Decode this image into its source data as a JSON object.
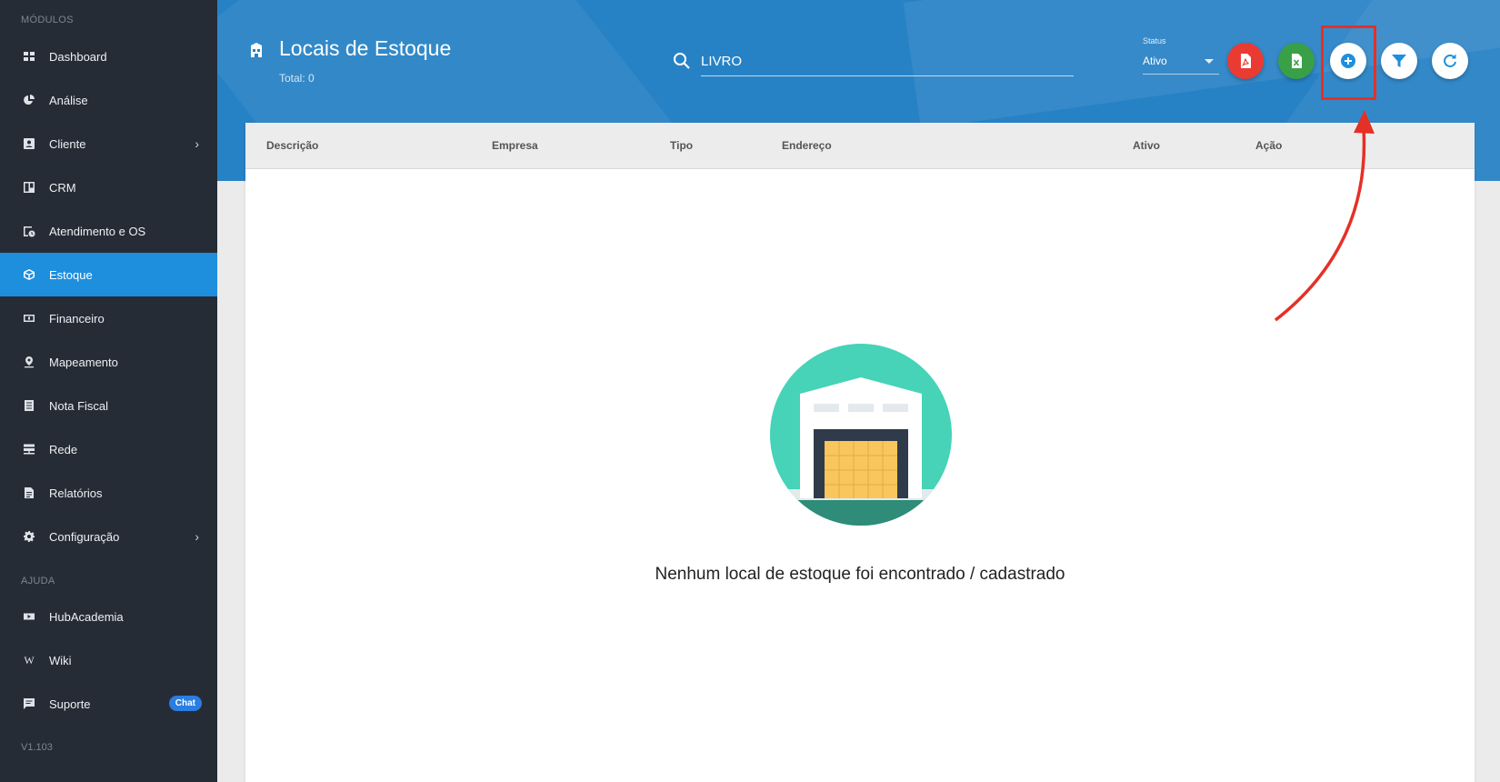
{
  "sidebar": {
    "section_modules": "MÓDULOS",
    "section_help": "AJUDA",
    "items": [
      {
        "label": "Dashboard",
        "icon": "grid-icon"
      },
      {
        "label": "Análise",
        "icon": "pie-chart-icon"
      },
      {
        "label": "Cliente",
        "icon": "contact-card-icon",
        "has_submenu": true
      },
      {
        "label": "CRM",
        "icon": "board-icon"
      },
      {
        "label": "Atendimento e OS",
        "icon": "calendar-clock-icon"
      },
      {
        "label": "Estoque",
        "icon": "box-icon",
        "active": true
      },
      {
        "label": "Financeiro",
        "icon": "money-icon"
      },
      {
        "label": "Mapeamento",
        "icon": "map-pin-icon"
      },
      {
        "label": "Nota Fiscal",
        "icon": "receipt-icon"
      },
      {
        "label": "Rede",
        "icon": "network-icon"
      },
      {
        "label": "Relatórios",
        "icon": "document-icon"
      },
      {
        "label": "Configuração",
        "icon": "gear-icon",
        "has_submenu": true
      }
    ],
    "help_items": [
      {
        "label": "HubAcademia",
        "icon": "youtube-icon"
      },
      {
        "label": "Wiki",
        "icon": "wikipedia-icon"
      },
      {
        "label": "Suporte",
        "icon": "chat-icon",
        "badge": "Chat"
      }
    ],
    "version": "V1.103"
  },
  "header": {
    "title": "Locais de Estoque",
    "total": "Total: 0",
    "search_value": "LIVRO",
    "status_label": "Status",
    "status_value": "Ativo",
    "actions": [
      "pdf-export",
      "excel-export",
      "add-new",
      "filter",
      "refresh"
    ]
  },
  "table": {
    "columns": [
      "Descrição",
      "Empresa",
      "Tipo",
      "Endereço",
      "Ativo",
      "Ação"
    ]
  },
  "empty_state": {
    "message": "Nenhum local de estoque foi encontrado / cadastrado"
  },
  "colors": {
    "sidebar_bg": "#262c36",
    "active_item": "#1e8fdc",
    "banner": "#2782c5",
    "pdf_button": "#ea3b33",
    "excel_button": "#3aa047",
    "highlight": "#e53026"
  }
}
